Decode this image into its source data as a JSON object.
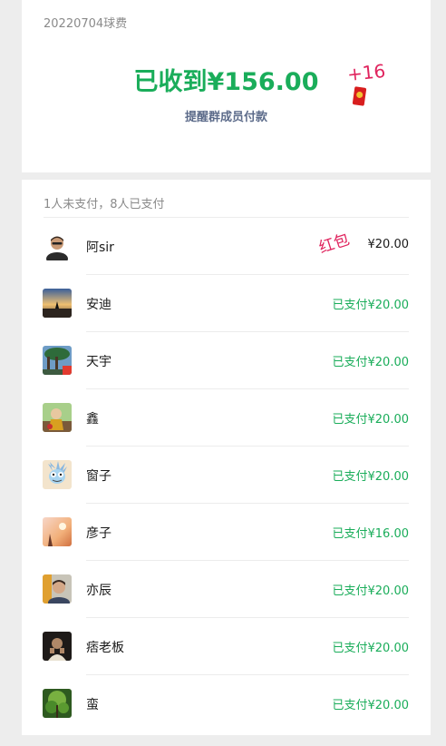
{
  "header": {
    "event_title": "20220704球费",
    "collected_text": "已收到¥156.00",
    "remind_label": "提醒群成员付款"
  },
  "annotations": {
    "plus_text": "+16",
    "red_packet_text": "红包"
  },
  "summary": "1人未支付，8人已支付",
  "members": [
    {
      "name": "阿sir",
      "amount": "¥20.00",
      "paid": false
    },
    {
      "name": "安迪",
      "amount": "已支付¥20.00",
      "paid": true
    },
    {
      "name": "天宇",
      "amount": "已支付¥20.00",
      "paid": true
    },
    {
      "name": "鑫",
      "amount": "已支付¥20.00",
      "paid": true
    },
    {
      "name": "窗子",
      "amount": "已支付¥20.00",
      "paid": true
    },
    {
      "name": "彦子",
      "amount": "已支付¥16.00",
      "paid": true
    },
    {
      "name": "亦辰",
      "amount": "已支付¥20.00",
      "paid": true
    },
    {
      "name": "痞老板",
      "amount": "已支付¥20.00",
      "paid": true
    },
    {
      "name": "蛮",
      "amount": "已支付¥20.00",
      "paid": true
    }
  ],
  "colors": {
    "paid_green": "#1aad5a",
    "annotation_pink": "#e0245e",
    "link_blue": "#5c6b8a",
    "page_bg": "#ededed"
  }
}
